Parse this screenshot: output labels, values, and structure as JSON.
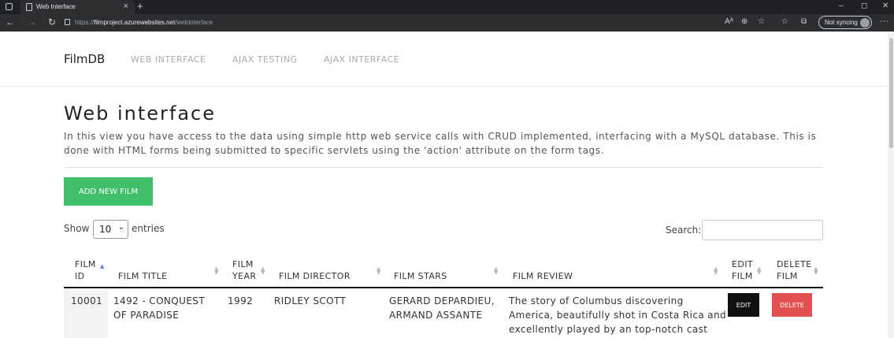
{
  "browser": {
    "tab_title": "Web Interface",
    "tab_close": "×",
    "new_tab": "+",
    "url_scheme": "https://",
    "url_host": "filmproject.azurewebsites.net",
    "url_path": "/webInterface",
    "sync_label": "Not syncing",
    "win_min": "–",
    "win_max": "◻",
    "win_close": "✕",
    "back": "←",
    "forward": "→",
    "reload": "↻",
    "more": "···",
    "read_aloud": "A⁠ᴬ",
    "zoom": "⊕",
    "favorite": "☆",
    "favorites": "☆",
    "collections": "⧉"
  },
  "navbar": {
    "brand": "FilmDB",
    "links": [
      "WEB INTERFACE",
      "AJAX TESTING",
      "AJAX INTERFACE"
    ]
  },
  "main": {
    "title": "Web interface",
    "description": "In this view you have access to the data using simple http web service calls with CRUD implemented, interfacing with a MySQL database. This is done with HTML forms being submitted to specific servlets using the 'action' attribute on the form tags.",
    "add_button": "ADD NEW FILM",
    "show_label": "Show",
    "entries_value": "10",
    "entries_label": "entries",
    "search_label": "Search:"
  },
  "table": {
    "headers": [
      {
        "line1": "FILM",
        "line2": "ID"
      },
      {
        "line1": "",
        "line2": "FILM TITLE"
      },
      {
        "line1": "FILM",
        "line2": "YEAR"
      },
      {
        "line1": "",
        "line2": "FILM DIRECTOR"
      },
      {
        "line1": "",
        "line2": "FILM STARS"
      },
      {
        "line1": "",
        "line2": "FILM REVIEW"
      },
      {
        "line1": "EDIT",
        "line2": "FILM"
      },
      {
        "line1": "DELETE",
        "line2": "FILM"
      }
    ],
    "rows": [
      {
        "id": "10001",
        "title_l1": "1492 - CONQUEST",
        "title_l2": "OF PARADISE",
        "year": "1992",
        "director": "RIDLEY SCOTT",
        "stars_l1": "GERARD DEPARDIEU,",
        "stars_l2": "ARMAND ASSANTE",
        "review_l1": "The story of Columbus discovering",
        "review_l2": "America, beautifully shot in Costa Rica and",
        "review_l3": "excellently played by an top-notch cast",
        "edit_label": "EDIT",
        "delete_label": "DELETE"
      }
    ]
  },
  "colors": {
    "add_button": "#3fbf6a",
    "edit_button": "#111111",
    "delete_button": "#e0514f",
    "sort_active": "#5a7bd8"
  }
}
